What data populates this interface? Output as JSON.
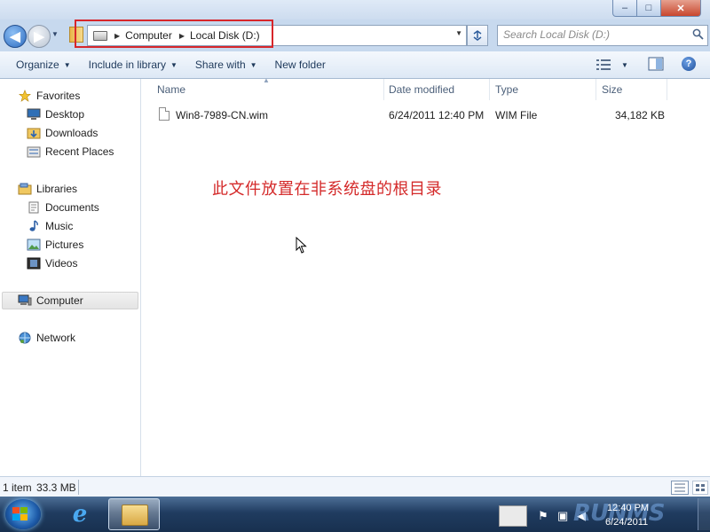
{
  "window": {
    "minimize_glyph": "–",
    "maximize_glyph": "□",
    "close_glyph": "✕"
  },
  "address": {
    "crumbs": [
      "Computer",
      "Local Disk (D:)"
    ],
    "search_placeholder": "Search Local Disk (D:)"
  },
  "toolbar": {
    "organize": "Organize",
    "include_in_library": "Include in library",
    "share_with": "Share with",
    "new_folder": "New folder",
    "help": "?"
  },
  "nav": {
    "favorites": "Favorites",
    "desktop": "Desktop",
    "downloads": "Downloads",
    "recent_places": "Recent Places",
    "libraries": "Libraries",
    "documents": "Documents",
    "music": "Music",
    "pictures": "Pictures",
    "videos": "Videos",
    "computer": "Computer",
    "network": "Network"
  },
  "columns": {
    "name": "Name",
    "date_modified": "Date modified",
    "type": "Type",
    "size": "Size"
  },
  "files": [
    {
      "name": "Win8-7989-CN.wim",
      "date_modified": "6/24/2011 12:40 PM",
      "type": "WIM File",
      "size": "34,182 KB"
    }
  ],
  "annotation": "此文件放置在非系统盘的根目录",
  "status": {
    "count": "1 item",
    "size": "33.3 MB"
  },
  "taskbar": {
    "time": "12:40 PM",
    "date": "6/24/2011",
    "watermark": "RUNMS"
  },
  "colors": {
    "highlight_border": "#d7262b",
    "annotation_text": "#d42a2a"
  }
}
